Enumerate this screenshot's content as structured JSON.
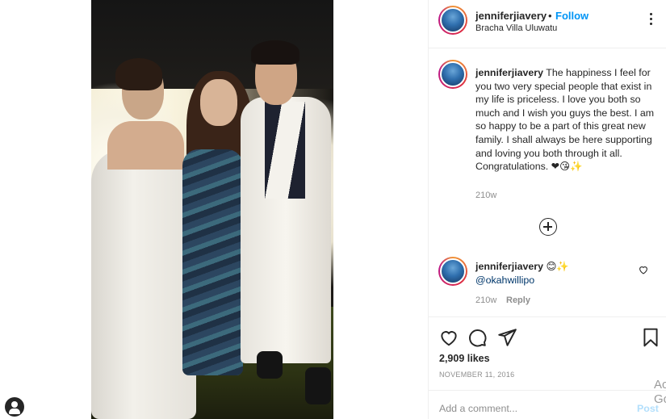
{
  "post": {
    "username": "jenniferjiavery",
    "separator": "•",
    "follow_label": "Follow",
    "location": "Bracha Villa Uluwatu",
    "more_icon": "more-options-icon"
  },
  "caption": {
    "username": "jenniferjiavery",
    "text": " The happiness I feel for you two very special people that exist in my life is priceless. I love you both so much and I wish you guys the best. I am so happy to be a part of this great new family. I shall always be here supporting and loving you both through it all. Congratulations. ",
    "emojis": "❤😘✨",
    "time": "210w"
  },
  "comment": {
    "username": "jenniferjiavery",
    "emojis": "😊✨",
    "mention": "@okahwillipo",
    "time": "210w",
    "reply_label": "Reply"
  },
  "actions": {
    "likes": "2,909 likes",
    "date": "NOVEMBER 11, 2016"
  },
  "add_comment": {
    "placeholder": "Add a comment...",
    "post_label": "Post"
  },
  "watermark": "Ac\nGo",
  "colors": {
    "link_blue": "#0095f6",
    "post_disabled": "#b2dffc",
    "muted": "#8e8e8e",
    "text": "#262626"
  }
}
